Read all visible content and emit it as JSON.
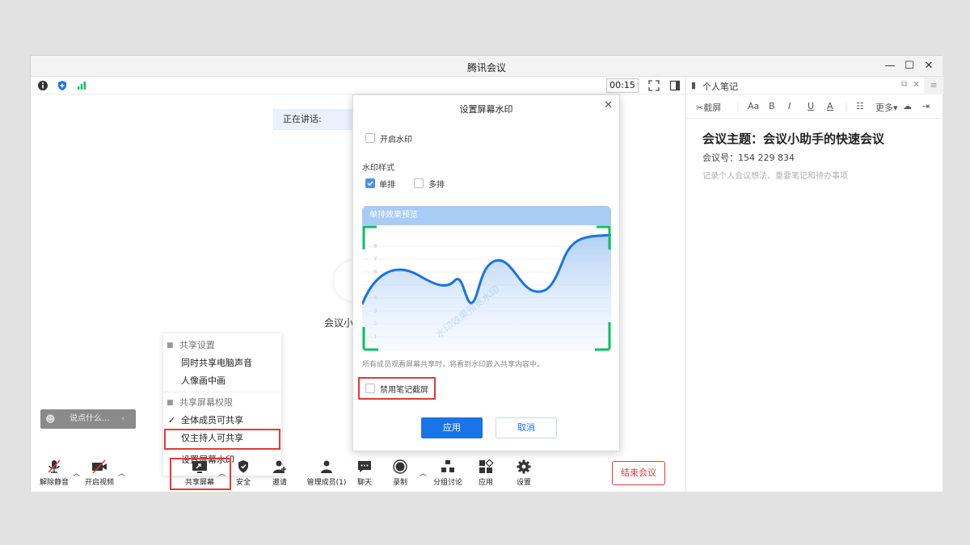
{
  "window": {
    "title": "腾讯会议"
  },
  "status": {
    "timer": "00:15"
  },
  "meeting": {
    "speaking_label": "正在讲话:",
    "participant_name": "会议小"
  },
  "chat": {
    "placeholder": "说点什么..."
  },
  "share_menu": {
    "section1": "共享设置",
    "items1": [
      "同时共享电脑声音",
      "人像画中画"
    ],
    "section2": "共享屏幕权限",
    "items2": [
      "全体成员可共享",
      "仅主持人可共享"
    ],
    "checked_item": "全体成员可共享",
    "watermark_item": "设置屏幕水印"
  },
  "toolbar": {
    "mute": "解除静音",
    "video": "开启视频",
    "share": "共享屏幕",
    "security": "安全",
    "invite": "邀请",
    "members": "管理成员(1)",
    "chat": "聊天",
    "record": "录制",
    "breakout": "分组讨论",
    "apps": "应用",
    "settings": "设置",
    "end": "结束会议"
  },
  "dialog": {
    "title": "设置屏幕水印",
    "enable_label": "开启水印",
    "style_label": "水印样式",
    "single_label": "单排",
    "multi_label": "多排",
    "single_checked": true,
    "preview_title": "单排效果预览",
    "watermark_text": "水印效果预览水印",
    "notice": "所有成员观看屏幕共享时，将看到水印嵌入共享内容中。",
    "disable_label": "禁用笔记截屏",
    "apply": "应用",
    "cancel": "取消",
    "chart_ticks": [
      "8",
      "7",
      "6",
      "5",
      "4",
      "3",
      "2",
      "1"
    ]
  },
  "notes": {
    "title": "个人笔记",
    "screenshot": "截屏",
    "more": "更多",
    "heading": "会议主题：会议小助手的快速会议",
    "meeting_id": "会议号：154 229 834",
    "placeholder": "记录个人会议想法、重要笔记和待办事项"
  },
  "colors": {
    "accent": "#1a73e8",
    "danger": "#e53935",
    "green": "#07c160"
  }
}
